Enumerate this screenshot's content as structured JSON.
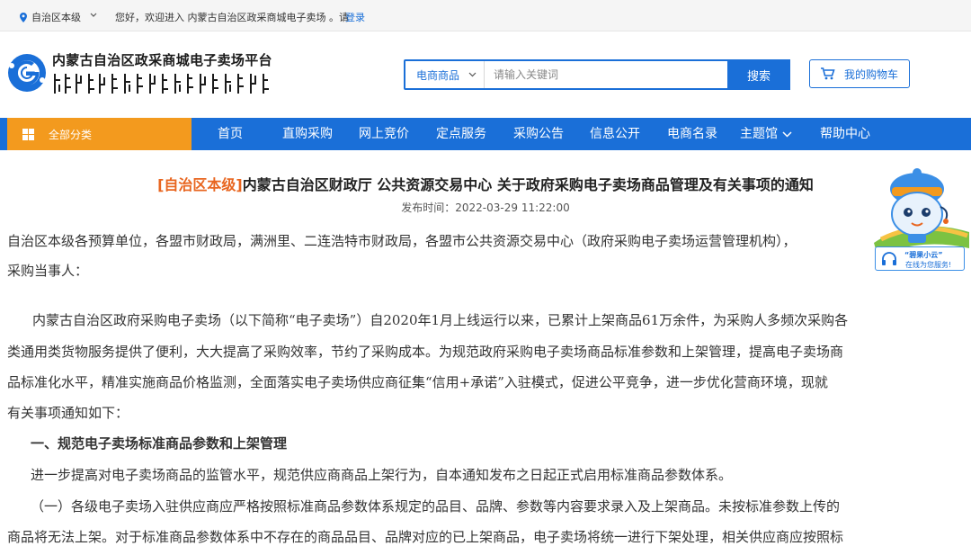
{
  "topbar": {
    "location": "自治区本级",
    "welcome": "您好，欢迎进入 内蒙古自治区政采商城电子卖场 。请",
    "login": "登录"
  },
  "header": {
    "brand_cn": "内蒙古自治区政采商城电子卖场平台",
    "search": {
      "category": "电商商品",
      "placeholder": "请输入关键词",
      "button": "搜索"
    },
    "cart": "我的购物车"
  },
  "nav": {
    "all_categories": "全部分类",
    "items": [
      "首页",
      "直购采购",
      "网上竞价",
      "定点服务",
      "采购公告",
      "信息公开",
      "电商名录",
      "主题馆",
      "帮助中心"
    ]
  },
  "article": {
    "tag": "[自治区本级]",
    "title": "内蒙古自治区财政厅 公共资源交易中心 关于政府采购电子卖场商品管理及有关事项的通知",
    "pubtime": "发布时间：2022-03-29 11:22:00",
    "lines": [
      "自治区本级各预算单位，各盟市财政局，满洲里、二连浩特市财政局，各盟市公共资源交易中心（政府采购电子卖场运营管理机构），",
      "采购当事人：",
      "内蒙古自治区政府采购电子卖场（以下简称“电子卖场”）自2020年1月上线运行以来，已累计上架商品61万余件，为采购人多频次采购各",
      "类通用类货物服务提供了便利，大大提高了采购效率，节约了采购成本。为规范政府采购电子卖场商品标准参数和上架管理，提高电子卖场商",
      "品标准化水平，精准实施商品价格监测，全面落实电子卖场供应商征集“信用+承诺”入驻模式，促进公平竞争，进一步优化营商环境，现就",
      "有关事项通知如下：",
      "一、规范电子卖场标准商品参数和上架管理",
      "进一步提高对电子卖场商品的监管水平，规范供应商商品上架行为，自本通知发布之日起正式启用标准商品参数体系。",
      "（一）各级电子卖场入驻供应商应严格按照标准商品参数体系规定的品目、品牌、参数等内容要求录入及上架商品。未按标准参数上传的",
      "商品将无法上架。对于标准商品参数体系中不存在的商品品目、品牌对应的已上架商品，电子卖场将统一进行下架处理，相关供应商应按照标"
    ]
  },
  "mascot": {
    "title": "“碧果小云”",
    "subtitle": "在线为您服务!"
  },
  "colors": {
    "primary": "#1a6fd8",
    "accent": "#f39a1e",
    "tag": "#e8651f"
  }
}
